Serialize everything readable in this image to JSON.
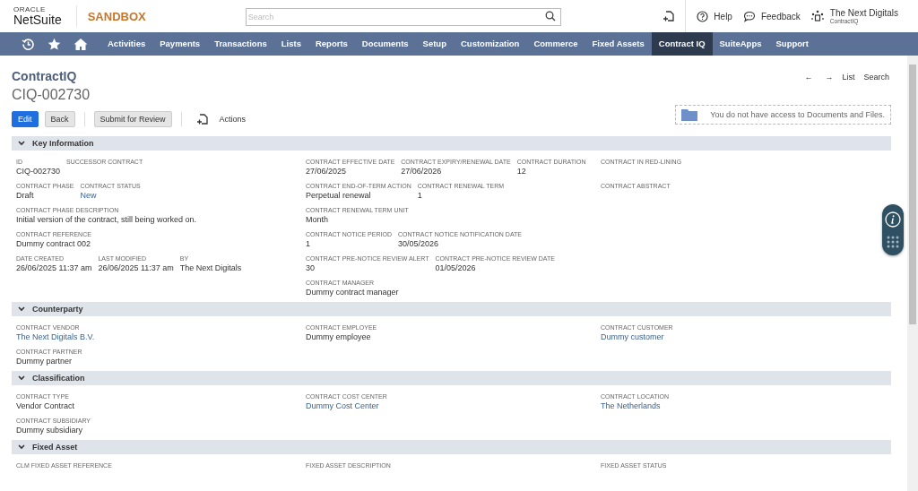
{
  "header": {
    "logo_top": "ORACLE",
    "logo_bottom": "NetSuite",
    "environment": "SANDBOX",
    "search": {
      "placeholder": "Search"
    },
    "help": "Help",
    "feedback": "Feedback",
    "user": {
      "name": "The Next Digitals",
      "role": "ContractIQ"
    }
  },
  "nav": [
    {
      "label": "Activities",
      "selected": false
    },
    {
      "label": "Payments",
      "selected": false
    },
    {
      "label": "Transactions",
      "selected": false
    },
    {
      "label": "Lists",
      "selected": false
    },
    {
      "label": "Reports",
      "selected": false
    },
    {
      "label": "Documents",
      "selected": false
    },
    {
      "label": "Setup",
      "selected": false
    },
    {
      "label": "Customization",
      "selected": false
    },
    {
      "label": "Commerce",
      "selected": false
    },
    {
      "label": "Fixed Assets",
      "selected": false
    },
    {
      "label": "Contract IQ",
      "selected": true
    },
    {
      "label": "SuiteApps",
      "selected": false
    },
    {
      "label": "Support",
      "selected": false
    }
  ],
  "record": {
    "type": "ContractIQ",
    "id": "CIQ-002730",
    "buttons": [
      {
        "label": "Edit",
        "kind": "primary"
      },
      {
        "label": "Back",
        "kind": "secondary"
      },
      {
        "label": "Submit for Review",
        "kind": "secondary"
      }
    ],
    "actions": "Actions",
    "previous": "←",
    "next": "→",
    "list": "List",
    "search": "Search",
    "documents_notice": "You do not have access to Documents and Files."
  },
  "sections": [
    {
      "title": "Key Information",
      "expanded": true,
      "columns": [
        [
          [
            {
              "label": "ID",
              "value": "CIQ-002730",
              "link": false
            },
            {
              "label": "SUCCESSOR CONTRACT"
            }
          ],
          [
            {
              "label": "CONTRACT PHASE",
              "value": "Draft",
              "link": false
            },
            {
              "label": "CONTRACT STATUS",
              "value": "New",
              "link": true
            }
          ],
          [
            {
              "label": "CONTRACT PHASE DESCRIPTION",
              "value": "Initial version of the contract, still being worked on.",
              "link": false
            }
          ],
          [
            {
              "label": "CONTRACT REFERENCE",
              "value": "Dummy contract 002",
              "link": false
            }
          ],
          [
            {
              "label": "DATE CREATED",
              "value": "26/06/2025 11:37 am",
              "link": false
            },
            {
              "label": "LAST MODIFIED",
              "value": "26/06/2025 11:37 am",
              "link": false
            },
            {
              "label": "BY",
              "value": "The Next Digitals",
              "link": false
            }
          ]
        ],
        [
          [
            {
              "label": "CONTRACT EFFECTIVE DATE",
              "value": "27/06/2025",
              "link": false
            },
            {
              "label": "CONTRACT EXPIRY/RENEWAL DATE",
              "value": "27/06/2026",
              "link": false
            },
            {
              "label": "CONTRACT DURATION",
              "value": "12",
              "link": false
            }
          ],
          [
            {
              "label": "CONTRACT END-OF-TERM ACTION",
              "value": "Perpetual renewal",
              "link": false
            },
            {
              "label": "CONTRACT RENEWAL TERM",
              "value": "1",
              "link": false
            }
          ],
          [
            {
              "label": "CONTRACT RENEWAL TERM UNIT",
              "value": "Month",
              "link": false
            }
          ],
          [
            {
              "label": "CONTRACT NOTICE PERIOD",
              "value": "1",
              "link": false
            },
            {
              "label": "CONTRACT NOTICE NOTIFICATION DATE",
              "value": "30/05/2026",
              "link": false
            }
          ],
          [
            {
              "label": "CONTRACT PRE-NOTICE REVIEW ALERT",
              "value": "30",
              "link": false
            },
            {
              "label": "CONTRACT PRE-NOTICE REVIEW DATE",
              "value": "01/05/2026",
              "link": false
            }
          ],
          [
            {
              "label": "CONTRACT MANAGER",
              "value": "Dummy contract manager",
              "link": false
            }
          ]
        ],
        [
          [
            {
              "label": "CONTRACT IN RED-LINING"
            }
          ],
          [
            {
              "label": "CONTRACT ABSTRACT"
            }
          ]
        ]
      ]
    },
    {
      "title": "Counterparty",
      "expanded": true,
      "columns": [
        [
          [
            {
              "label": "CONTRACT VENDOR",
              "value": "The Next Digitals B.V.",
              "link": true
            }
          ],
          [
            {
              "label": "CONTRACT PARTNER",
              "value": "Dummy partner",
              "link": false
            }
          ]
        ],
        [
          [
            {
              "label": "CONTRACT EMPLOYEE",
              "value": "Dummy employee",
              "link": false
            }
          ]
        ],
        [
          [
            {
              "label": "CONTRACT CUSTOMER",
              "value": "Dummy customer",
              "link": true
            }
          ]
        ]
      ]
    },
    {
      "title": "Classification",
      "expanded": true,
      "columns": [
        [
          [
            {
              "label": "CONTRACT TYPE",
              "value": "Vendor Contract",
              "link": false
            }
          ],
          [
            {
              "label": "CONTRACT SUBSIDIARY",
              "value": "Dummy subsidiary",
              "link": false
            }
          ]
        ],
        [
          [
            {
              "label": "CONTRACT COST CENTER",
              "value": "Dummy Cost Center",
              "link": true
            }
          ]
        ],
        [
          [
            {
              "label": "CONTRACT LOCATION",
              "value": "The Netherlands",
              "link": true
            }
          ]
        ]
      ]
    },
    {
      "title": "Fixed Asset",
      "expanded": true,
      "columns": [
        [
          [
            {
              "label": "CLM FIXED ASSET REFERENCE"
            }
          ]
        ],
        [
          [
            {
              "label": "FIXED ASSET DESCRIPTION"
            }
          ]
        ],
        [
          [
            {
              "label": "FIXED ASSET STATUS"
            }
          ]
        ]
      ]
    }
  ]
}
